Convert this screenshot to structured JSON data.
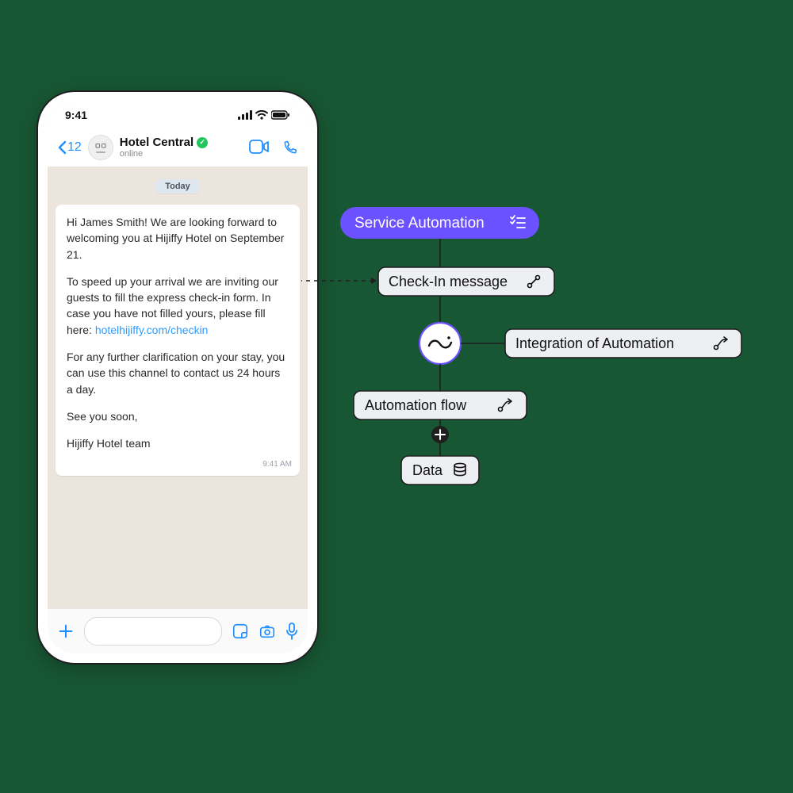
{
  "statusbar": {
    "time": "9:41"
  },
  "header": {
    "back_badge": "12",
    "contact_name": "Hotel Central",
    "presence": "online"
  },
  "chat": {
    "date_chip": "Today",
    "timestamp": "9:41 AM",
    "msg": {
      "p1": "Hi James Smith! We are looking forward to welcoming you at Hijiffy Hotel on September 21.",
      "p2a": "To speed up your arrival we are inviting our guests to fill the express check-in form. In case you have not filled yours, please fill here: ",
      "link": "hotelhijiffy.com/checkin",
      "p3": "For any further clarification on your stay, you can use this channel to contact us 24 hours a day.",
      "p4": "See you soon,",
      "p5": "Hijiffy Hotel team"
    }
  },
  "flow": {
    "service_automation": "Service Automation",
    "check_in": "Check-In message",
    "integration": "Integration of Automation",
    "automation_flow": "Automation flow",
    "data": "Data"
  }
}
